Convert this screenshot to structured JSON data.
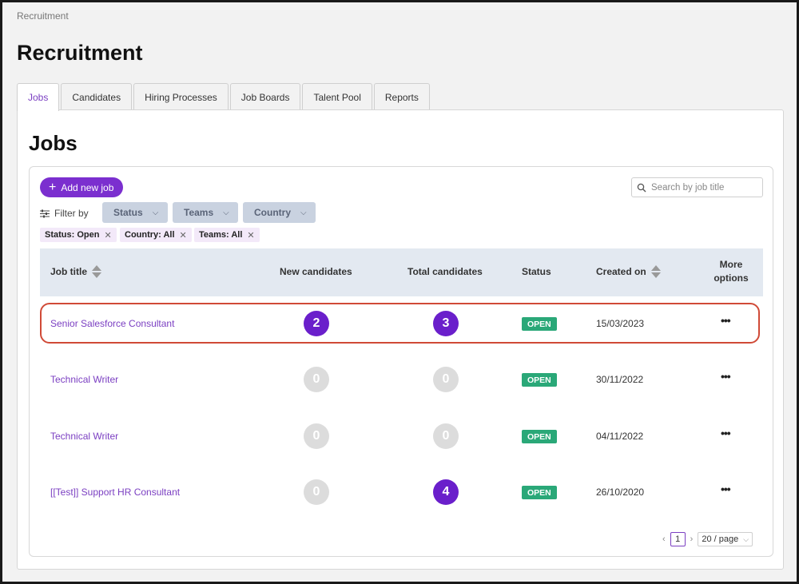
{
  "breadcrumb": "Recruitment",
  "page_title": "Recruitment",
  "tabs": [
    {
      "label": "Jobs",
      "active": true
    },
    {
      "label": "Candidates"
    },
    {
      "label": "Hiring Processes"
    },
    {
      "label": "Job Boards"
    },
    {
      "label": "Talent Pool"
    },
    {
      "label": "Reports"
    }
  ],
  "section_title": "Jobs",
  "add_button": "Add new job",
  "search": {
    "placeholder": "Search by job title",
    "value": ""
  },
  "filter": {
    "label": "Filter by",
    "dropdowns": [
      "Status",
      "Teams",
      "Country"
    ],
    "chips": [
      "Status: Open",
      "Country: All",
      "Teams: All"
    ]
  },
  "table": {
    "headers": {
      "job_title": "Job title",
      "new_candidates": "New candidates",
      "total_candidates": "Total candidates",
      "status": "Status",
      "created_on": "Created on",
      "more_options_1": "More",
      "more_options_2": "options"
    },
    "rows": [
      {
        "title": "Senior Salesforce Consultant",
        "new": "2",
        "total": "3",
        "status": "OPEN",
        "created": "15/03/2023",
        "highlighted": true
      },
      {
        "title": "Technical Writer",
        "new": "0",
        "total": "0",
        "status": "OPEN",
        "created": "30/11/2022"
      },
      {
        "title": "Technical Writer",
        "new": "0",
        "total": "0",
        "status": "OPEN",
        "created": "04/11/2022"
      },
      {
        "title": "[[Test]] Support HR Consultant",
        "new": "0",
        "total": "4",
        "status": "OPEN",
        "created": "26/10/2020"
      }
    ]
  },
  "pagination": {
    "current_page": "1",
    "page_size": "20 / page"
  },
  "colors": {
    "accent": "#7b2fcf",
    "status_open": "#2aa878",
    "highlight": "#d04a37"
  }
}
